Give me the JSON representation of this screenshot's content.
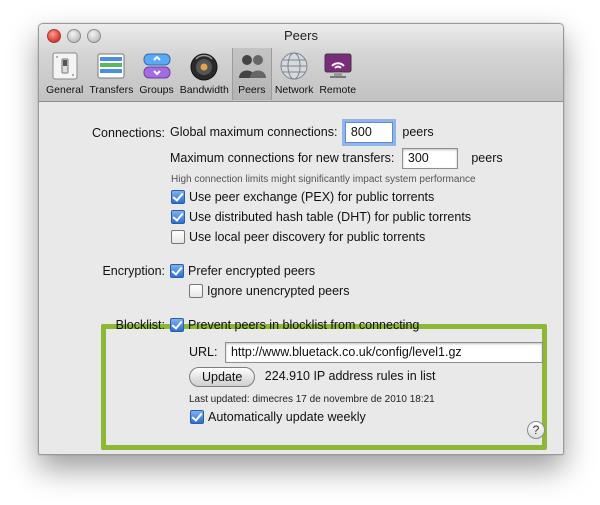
{
  "window": {
    "title": "Peers"
  },
  "toolbar": {
    "items": [
      {
        "label": "General",
        "icon": "switch-icon"
      },
      {
        "label": "Transfers",
        "icon": "transfers-icon"
      },
      {
        "label": "Groups",
        "icon": "groups-icon"
      },
      {
        "label": "Bandwidth",
        "icon": "bandwidth-icon"
      },
      {
        "label": "Peers",
        "icon": "peers-icon",
        "active": true
      },
      {
        "label": "Network",
        "icon": "network-icon"
      },
      {
        "label": "Remote",
        "icon": "remote-icon"
      }
    ]
  },
  "connections": {
    "label": "Connections:",
    "global_label": "Global maximum connections:",
    "global_value": "800",
    "global_unit": "peers",
    "new_label": "Maximum connections for new transfers:",
    "new_value": "300",
    "new_unit": "peers",
    "hint": "High connection limits might significantly impact system performance",
    "pex_label": "Use peer exchange (PEX) for public torrents",
    "dht_label": "Use distributed hash table (DHT) for public torrents",
    "lpd_label": "Use local peer discovery for public torrents"
  },
  "encryption": {
    "label": "Encryption:",
    "prefer_label": "Prefer encrypted peers",
    "ignore_label": "Ignore unencrypted peers"
  },
  "blocklist": {
    "label": "Blocklist:",
    "prevent_label": "Prevent peers in blocklist from connecting",
    "url_label": "URL:",
    "url_value": "http://www.bluetack.co.uk/config/level1.gz",
    "update_button": "Update",
    "rules_count": "224.910 IP address rules in list",
    "last_updated": "Last updated: dimecres 17 de novembre de 2010 18:21",
    "auto_update_label": "Automatically update weekly"
  },
  "help": {
    "glyph": "?"
  },
  "colors": {
    "highlight": "#8cb836",
    "accent": "#2b6fd6",
    "focus_ring": "#8fb5ea"
  }
}
